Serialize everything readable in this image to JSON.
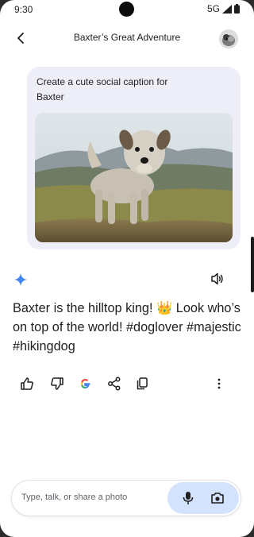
{
  "status_bar": {
    "time": "9:30",
    "network": "5G"
  },
  "header": {
    "title": "Baxter’s Great Adventure"
  },
  "prompt": {
    "text": "Create a cute social caption for Baxter"
  },
  "response": {
    "text": "Baxter is the hilltop king! 👑 Look who’s on top of the world! #doglover #majestic #hikingdog"
  },
  "actions": [
    {
      "icon": "thumbs-up-icon"
    },
    {
      "icon": "thumbs-down-icon"
    },
    {
      "icon": "google-icon"
    },
    {
      "icon": "share-icon"
    },
    {
      "icon": "copy-icon"
    },
    {
      "icon": "more-vert-icon"
    }
  ],
  "input": {
    "placeholder": "Type, talk, or share a photo"
  },
  "colors": {
    "prompt_bubble": "#edeef8",
    "input_tools": "#d3e3fd",
    "accent_blue": "#4285f4"
  }
}
